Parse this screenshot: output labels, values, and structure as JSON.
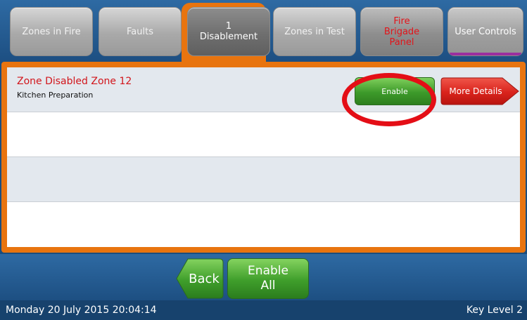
{
  "tabs": [
    {
      "label": "Zones in Fire"
    },
    {
      "label": "Faults"
    },
    {
      "count": "1",
      "label": "Disablement"
    },
    {
      "label": "Zones in Test"
    },
    {
      "line1": "Fire",
      "line2": "Brigade",
      "line3": "Panel"
    },
    {
      "label": "User Controls"
    }
  ],
  "rows": [
    {
      "title": "Zone Disabled Zone 12",
      "subtitle": "Kitchen Preparation",
      "enable_label": "Enable",
      "details_label": "More Details"
    }
  ],
  "footer": {
    "back_label": "Back",
    "enable_all_line1": "Enable",
    "enable_all_line2": "All"
  },
  "status": {
    "datetime": "Monday 20 July 2015 20:04:14",
    "key_level": "Key Level 2"
  },
  "colors": {
    "accent": "#e8740f",
    "alarm_text": "#d2151b",
    "highlight": "#e40e16",
    "button_green": "#3d9a2a",
    "button_red": "#d9231c"
  }
}
